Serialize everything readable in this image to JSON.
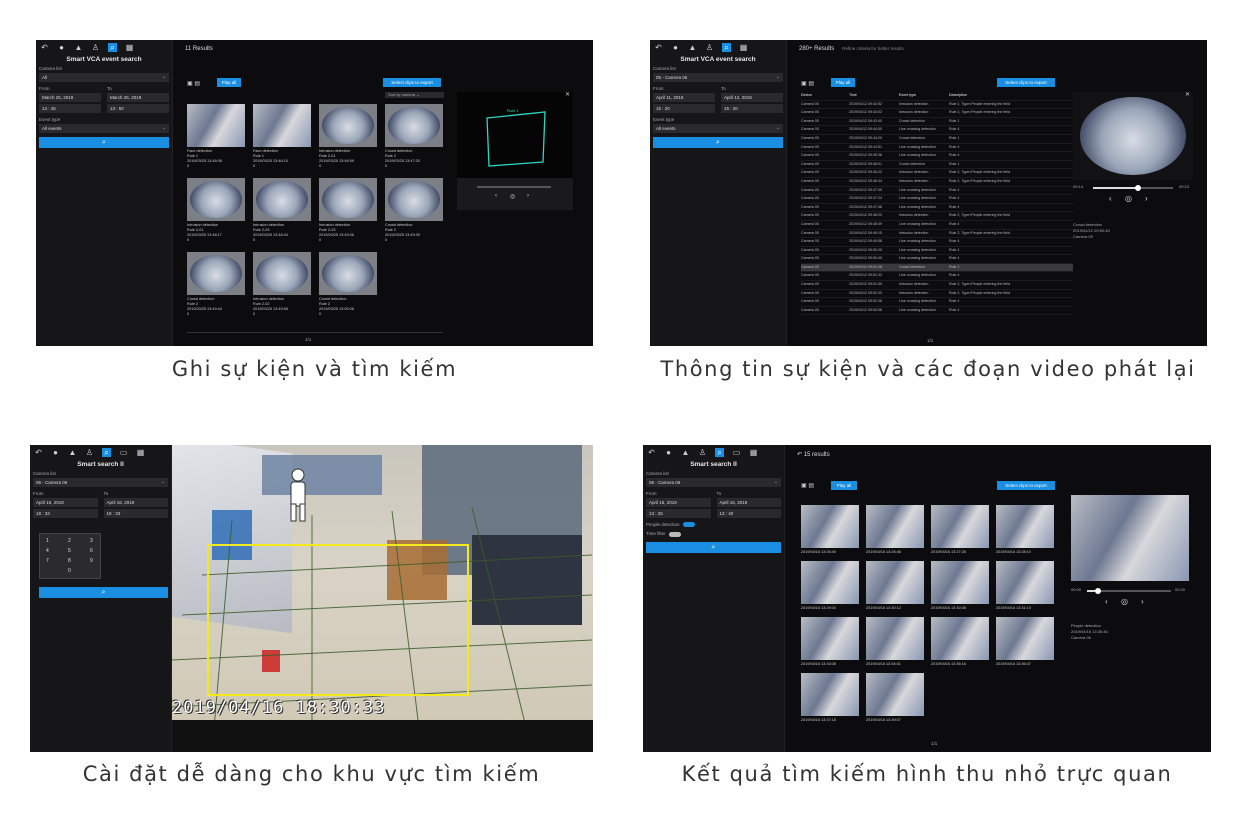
{
  "captions": {
    "tl": "Ghi sự kiện và tìm kiếm",
    "tr": "Thông tin sự kiện và các đoạn video phát lại",
    "bl": "Cài đặt dễ dàng cho khu vực tìm kiếm",
    "br": "Kết quả tìm kiếm hình thu nhỏ trực quan"
  },
  "colors": {
    "accent": "#1a8ee0",
    "panel_bg": "#0c0c0e",
    "sidebar_bg": "#161618",
    "zone": "#f4e81e"
  },
  "icons": [
    "back-arrow-icon",
    "camera-icon",
    "bell-icon",
    "person-icon",
    "search-icon",
    "calendar-icon",
    "grid-icon"
  ],
  "panel1": {
    "title": "Smart VCA event search",
    "camera_list_label": "Camera list",
    "camera_value": "All",
    "from_label": "From",
    "to_label": "To",
    "from_date": "March 25, 2019",
    "to_date": "March 26, 2019",
    "from_time": "13 : 45",
    "to_time": "13 : 50",
    "event_type_label": "Event type",
    "event_type_value": "All events",
    "results": "11 Results",
    "play_all": "Play all",
    "export": "Select clips to export",
    "sort": "Sort by camera",
    "rule_label": "Rule 1",
    "page": "1/1",
    "thumbs": [
      {
        "t": "Face detection",
        "r": "Rule 1",
        "d": "2019/03/25 13:46:06",
        "n": "0",
        "kind": "people"
      },
      {
        "t": "Face detection",
        "r": "Rule 1",
        "d": "2019/03/25 13:46:15",
        "n": "0",
        "kind": "people"
      },
      {
        "t": "Intrusion detection",
        "r": "Rule 2-01",
        "d": "2019/03/25 13:46:59",
        "n": "0",
        "kind": "fish"
      },
      {
        "t": "Crowd detection",
        "r": "Rule 2",
        "d": "2019/03/25 13:47:20",
        "n": "0",
        "kind": "fish"
      },
      {
        "t": "Intrusion detection",
        "r": "Rule 2-01",
        "d": "2019/03/25 13:48:17",
        "n": "0",
        "kind": "fish"
      },
      {
        "t": "Intrusion detection",
        "r": "Rule 2-03",
        "d": "2019/03/25 13:48:44",
        "n": "0",
        "kind": "fish"
      },
      {
        "t": "Intrusion detection",
        "r": "Rule 2-03",
        "d": "2019/03/25 13:49:06",
        "n": "0",
        "kind": "fish"
      },
      {
        "t": "Crowd detection",
        "r": "Rule 2",
        "d": "2019/03/25 13:49:30",
        "n": "0",
        "kind": "fish"
      },
      {
        "t": "Crowd detection",
        "r": "Rule 2",
        "d": "2019/03/25 13:49:44",
        "n": "0",
        "kind": "fish"
      },
      {
        "t": "Intrusion detection",
        "r": "Rule 2-02",
        "d": "2019/03/25 13:49:58",
        "n": "0",
        "kind": "fish"
      },
      {
        "t": "Crowd detection",
        "r": "Rule 2",
        "d": "2019/03/25 13:50:06",
        "n": "0",
        "kind": "fish"
      }
    ]
  },
  "panel2": {
    "title": "Smart VCA event search",
    "camera_list_label": "Camera list",
    "camera_value": "05 - Camera 05",
    "from_label": "From",
    "to_label": "To",
    "from_date": "April 11, 2019",
    "to_date": "April 12, 2019",
    "from_time": "15 : 20",
    "to_time": "15 : 20",
    "event_type_label": "Event type",
    "event_type_value": "All events",
    "results": "280+ Results",
    "hint": "Refine criteria for better results",
    "play_all": "Play all",
    "export": "Select clips to export",
    "headers": [
      "Device",
      "Time",
      "Event type",
      "Description"
    ],
    "rows": [
      [
        "Camera 05",
        "2019/04/12 09:42:52",
        "Intrusion detection",
        "Rule 2, Type=People entering the field"
      ],
      [
        "Camera 05",
        "2019/04/12 09:43:02",
        "Intrusion detection",
        "Rule 2, Type=People entering the field"
      ],
      [
        "Camera 05",
        "2019/04/12 09:43:40",
        "Crowd detection",
        "Rule 1"
      ],
      [
        "Camera 05",
        "2019/04/12 09:44:00",
        "Line crossing detection",
        "Rule 4"
      ],
      [
        "Camera 05",
        "2019/04/12 09:44:20",
        "Crowd detection",
        "Rule 1"
      ],
      [
        "Camera 05",
        "2019/04/12 09:44:51",
        "Line crossing detection",
        "Rule 4"
      ],
      [
        "Camera 05",
        "2019/04/12 09:45:38",
        "Line crossing detection",
        "Rule 4"
      ],
      [
        "Camera 05",
        "2019/04/12 09:46:01",
        "Crowd detection",
        "Rule 1"
      ],
      [
        "Camera 05",
        "2019/04/12 09:46:22",
        "Intrusion detection",
        "Rule 2, Type=People entering the field"
      ],
      [
        "Camera 05",
        "2019/04/12 09:46:44",
        "Intrusion detection",
        "Rule 2, Type=People entering the field"
      ],
      [
        "Camera 05",
        "2019/04/12 09:47:05",
        "Line crossing detection",
        "Rule 4"
      ],
      [
        "Camera 05",
        "2019/04/12 09:47:24",
        "Line crossing detection",
        "Rule 4"
      ],
      [
        "Camera 05",
        "2019/04/12 09:47:48",
        "Line crossing detection",
        "Rule 4"
      ],
      [
        "Camera 05",
        "2019/04/12 09:48:20",
        "Intrusion detection",
        "Rule 2, Type=People entering the field"
      ],
      [
        "Camera 05",
        "2019/04/12 09:48:39",
        "Line crossing detection",
        "Rule 4"
      ],
      [
        "Camera 05",
        "2019/04/12 09:49:15",
        "Intrusion detection",
        "Rule 2, Type=People entering the field"
      ],
      [
        "Camera 05",
        "2019/04/12 09:49:58",
        "Line crossing detection",
        "Rule 4"
      ],
      [
        "Camera 05",
        "2019/04/12 09:50:25",
        "Line crossing detection",
        "Rule 4"
      ],
      [
        "Camera 05",
        "2019/04/12 09:50:45",
        "Line crossing detection",
        "Rule 4"
      ],
      [
        "Camera 05",
        "2019/04/12 09:51:08",
        "Crowd detection",
        "Rule 1"
      ],
      [
        "Camera 05",
        "2019/04/12 09:51:32",
        "Line crossing detection",
        "Rule 4"
      ],
      [
        "Camera 05",
        "2019/04/12 09:51:55",
        "Intrusion detection",
        "Rule 2, Type=People entering the field"
      ],
      [
        "Camera 05",
        "2019/04/12 09:52:20",
        "Intrusion detection",
        "Rule 2, Type=People entering the field"
      ],
      [
        "Camera 05",
        "2019/04/12 09:52:46",
        "Line crossing detection",
        "Rule 4"
      ],
      [
        "Camera 05",
        "2019/04/12 09:53:06",
        "Line crossing detection",
        "Rule 4"
      ]
    ],
    "selected_row": 19,
    "time_start": "09:14",
    "time_end": "09:23",
    "info": [
      "Crowd detection",
      "2019/04/12 09:50:45",
      "Camera 05"
    ],
    "page": "1/1"
  },
  "panel3": {
    "title": "Smart search II",
    "camera_label": "Camera list",
    "camera_value": "06 - Camera 06",
    "from_label": "From",
    "to_label": "To",
    "from_date": "April 16, 2019",
    "to_date": "April 16, 2019",
    "from_time": "18 : 33",
    "to_time": "18 : 33",
    "timestamp": "2019/04/16 18:30:33",
    "keypad": [
      "0",
      "1",
      "2",
      "3",
      "4",
      "5",
      "6",
      "7",
      "8",
      "9"
    ]
  },
  "panel4": {
    "title": "Smart search II",
    "camera_label": "Camera list",
    "camera_value": "06 - Camera 06",
    "from_label": "From",
    "to_label": "To",
    "from_date": "April 16, 2019",
    "to_date": "April 16, 2019",
    "from_time": "13 : 25",
    "to_time": "13 : 40",
    "people_detection": "People detection",
    "time_filter": "Time filter",
    "results": "15 results",
    "play_all": "Play all",
    "export": "Select clips to export",
    "thumbs": [
      "2019/04/16 13:25:40",
      "2019/04/16 13:26:46",
      "2019/04/16 13:27:26",
      "2019/04/16 13:28:10",
      "2019/04/16 13:29:04",
      "2019/04/16 13:30:12",
      "2019/04/16 13:30:35",
      "2019/04/16 13:31:10",
      "2019/04/16 13:33:08",
      "2019/04/16 13:34:01",
      "2019/04/16 13:35:16",
      "2019/04/16 13:36:47",
      "2019/04/16 13:37:18",
      "2019/04/16 13:39:07"
    ],
    "time_start": "00:00",
    "time_end": "00:20",
    "info": [
      "People detection",
      "2019/04/16 13:26:46",
      "Camera 06"
    ],
    "page": "1/1"
  }
}
